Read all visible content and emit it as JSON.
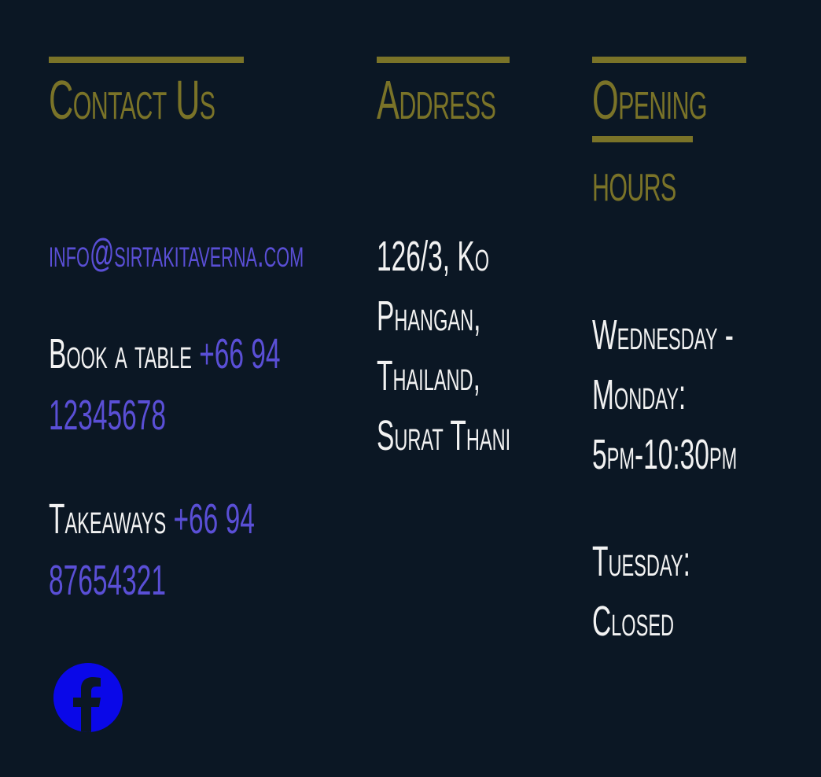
{
  "contact": {
    "heading": "Contact Us",
    "email": "info@sirtakitaverna.com",
    "book_label": "Book a table ",
    "book_phone_1": "+66 94",
    "book_phone_2": "12345678",
    "takeaway_label": "Takeaways ",
    "takeaway_phone_1": "+66 94",
    "takeaway_phone_2": "87654321",
    "social_icon": "facebook-icon"
  },
  "address": {
    "heading": "Address",
    "line1": "126/3, Ko",
    "line2": "Phangan,",
    "line3": "Thailand,",
    "line4": "Surat Thani"
  },
  "hours": {
    "heading_line1": "Opening",
    "heading_line2": "hours",
    "line1": "Wednesday -",
    "line2": "Monday:",
    "line3": "5pm-10:30pm",
    "line4": "Tuesday:",
    "line5": "Closed"
  },
  "colors": {
    "background": "#0b1724",
    "heading": "#7a7328",
    "body": "#f2f2f2",
    "link": "#5a4fd6",
    "facebook": "#0a08e8"
  }
}
